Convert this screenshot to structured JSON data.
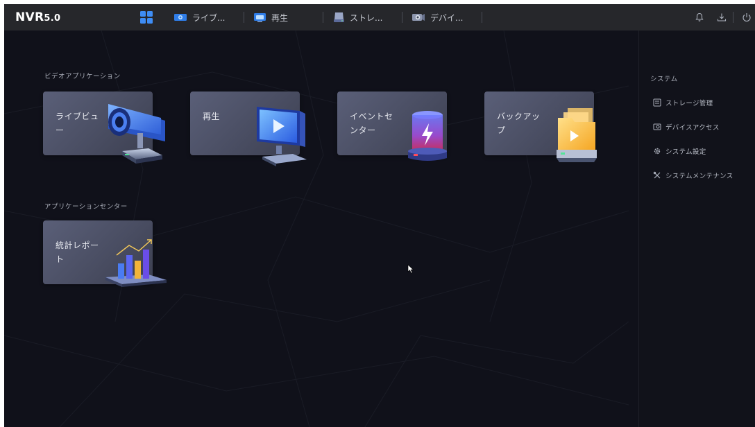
{
  "topbar": {
    "logo_main": "NVR",
    "logo_version": "5.0",
    "tabs": [
      {
        "label": "ライブ...",
        "icon": "live-view-icon"
      },
      {
        "label": "再生",
        "icon": "playback-icon"
      },
      {
        "label": "ストレ...",
        "icon": "storage-icon"
      },
      {
        "label": "デバイ...",
        "icon": "device-icon"
      }
    ],
    "right_icons": [
      "bell-icon",
      "download-icon",
      "power-icon"
    ]
  },
  "main": {
    "video_apps": {
      "label": "ビデオアプリケーション",
      "cards": [
        {
          "title": "ライブビュー",
          "icon": "camera-icon"
        },
        {
          "title": "再生",
          "icon": "monitor-icon"
        },
        {
          "title": "イベントセンター",
          "icon": "alarm-light-icon"
        },
        {
          "title": "バックアップ",
          "icon": "backup-folder-icon"
        }
      ]
    },
    "app_center": {
      "label": "アプリケーションセンター",
      "cards": [
        {
          "title": "統計レポート",
          "icon": "bar-chart-icon"
        }
      ]
    }
  },
  "right_panel": {
    "title": "システム",
    "items": [
      {
        "label": "ストレージ管理",
        "icon": "storage-management-icon"
      },
      {
        "label": "デバイスアクセス",
        "icon": "device-access-icon"
      },
      {
        "label": "システム設定",
        "icon": "gear-icon"
      },
      {
        "label": "システムメンテナンス",
        "icon": "tools-icon"
      }
    ]
  },
  "colors": {
    "accent": "#3e8df5",
    "background": "#10111a",
    "topbar": "#26272b",
    "card": "#4f5469"
  }
}
